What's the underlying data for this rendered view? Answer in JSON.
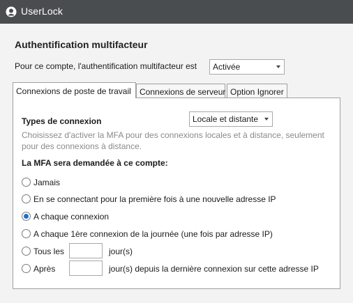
{
  "app": {
    "brand": "UserLock"
  },
  "dialog": {
    "title": "Authentification multifacteur",
    "status_label": "Pour ce compte, l'authentification multifacteur est",
    "status_value": "Activée"
  },
  "tabs": [
    {
      "label": "Connexions de poste de travail",
      "active": true
    },
    {
      "label": "Connexions de serveur",
      "active": false
    },
    {
      "label": "Option Ignorer",
      "active": false
    }
  ],
  "panel": {
    "connection_types_label": "Types de connexion",
    "connection_types_value": "Locale et distante",
    "description": "Choisissez d'activer la MFA pour des connexions locales et à distance, seulement pour des connexions à distance.",
    "mfa_label": "La MFA sera demandée à ce compte:",
    "options": [
      {
        "label": "Jamais",
        "checked": false
      },
      {
        "label": "En se connectant pour la première fois à une nouvelle adresse IP",
        "checked": false
      },
      {
        "label": "A chaque connexion",
        "checked": true
      },
      {
        "label": "A chaque 1ère connexion de la journée (une fois par adresse IP)",
        "checked": false
      },
      {
        "label": "Tous les",
        "suffix": "jour(s)",
        "value": "",
        "checked": false
      },
      {
        "label": "Après",
        "suffix": "jour(s) depuis la dernière connexion sur cette adresse IP",
        "value": "",
        "checked": false
      }
    ]
  }
}
